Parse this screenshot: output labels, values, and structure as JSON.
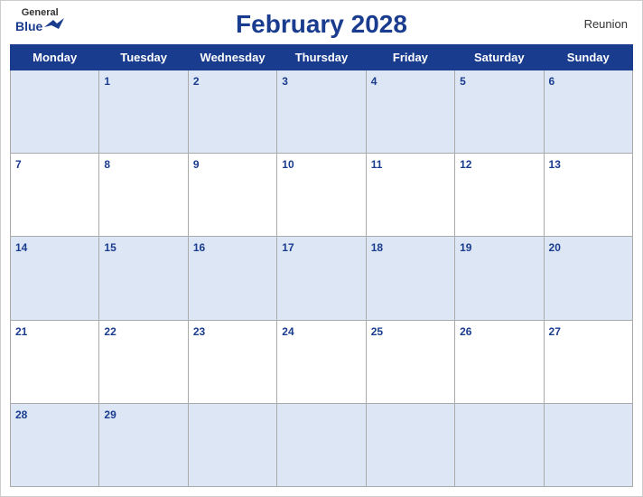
{
  "header": {
    "logo_general": "General",
    "logo_blue": "Blue",
    "title": "February 2028",
    "region": "Reunion"
  },
  "days": [
    "Monday",
    "Tuesday",
    "Wednesday",
    "Thursday",
    "Friday",
    "Saturday",
    "Sunday"
  ],
  "weeks": [
    [
      null,
      1,
      2,
      3,
      4,
      5,
      6
    ],
    [
      7,
      8,
      9,
      10,
      11,
      12,
      13
    ],
    [
      14,
      15,
      16,
      17,
      18,
      19,
      20
    ],
    [
      21,
      22,
      23,
      24,
      25,
      26,
      27
    ],
    [
      28,
      29,
      null,
      null,
      null,
      null,
      null
    ]
  ]
}
